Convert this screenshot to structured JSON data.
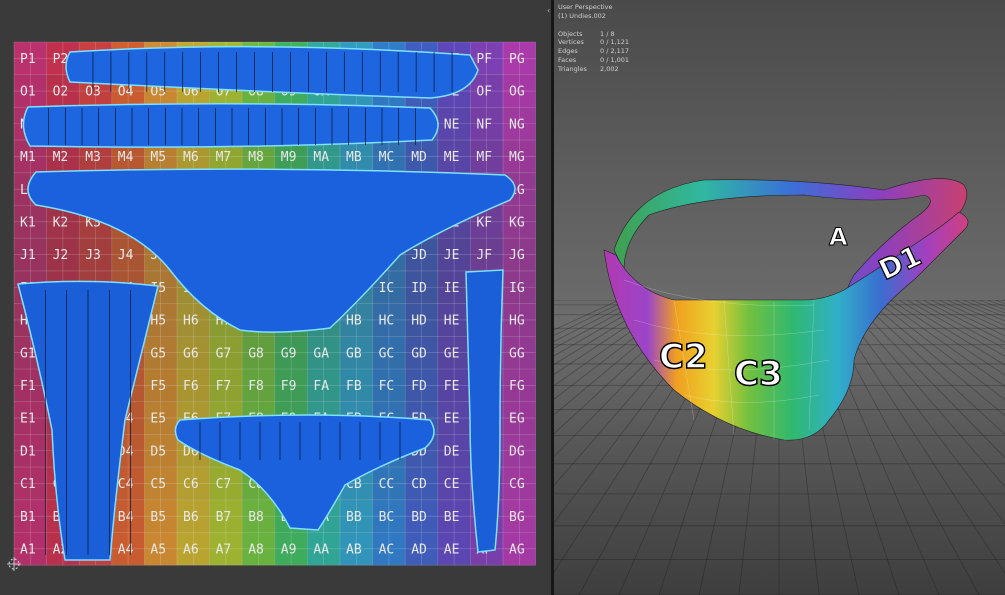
{
  "viewport": {
    "view_name": "User Perspective",
    "object_name": "(1) Undies.002",
    "stats": [
      {
        "key": "Objects",
        "value": "1 / 8"
      },
      {
        "key": "Vertices",
        "value": "0 / 1,121"
      },
      {
        "key": "Edges",
        "value": "0 / 2,117"
      },
      {
        "key": "Faces",
        "value": "0 / 1,001"
      },
      {
        "key": "Triangles",
        "value": "2,002"
      }
    ]
  },
  "uv_grid": {
    "rows": [
      "P",
      "O",
      "N",
      "M",
      "L",
      "K",
      "J",
      "I",
      "H",
      "G",
      "F",
      "E",
      "D",
      "C",
      "B",
      "A"
    ],
    "cols": [
      "1",
      "2",
      "3",
      "4",
      "5",
      "6",
      "7",
      "8",
      "9",
      "A",
      "B",
      "C",
      "D",
      "E",
      "F",
      "G"
    ]
  },
  "model_labels": [
    "C2",
    "C3",
    "D1",
    "A"
  ]
}
